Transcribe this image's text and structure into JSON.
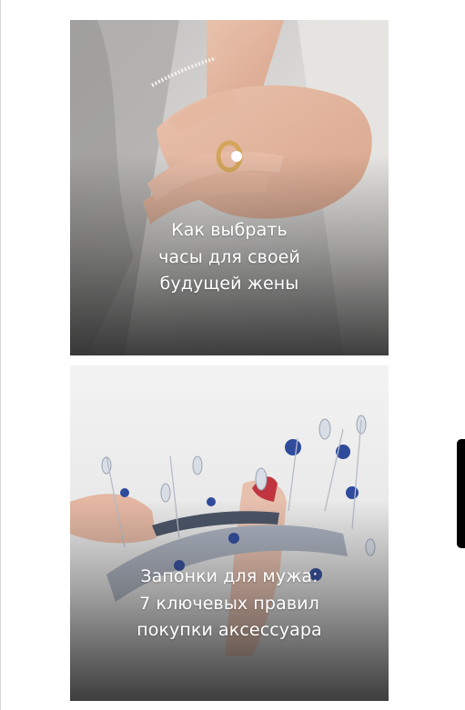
{
  "articles": [
    {
      "title": "Как выбрать часы для своей будущей жены",
      "image": "hands-with-rings-photo"
    },
    {
      "title": "Запонки для мужа: 7 ключевых правил покупки аксессуара",
      "image": "crystal-tiara-photo"
    }
  ],
  "colors": {
    "page_background": "#ffffff",
    "title_text": "#ffffff",
    "scrollbar": "#000000"
  }
}
